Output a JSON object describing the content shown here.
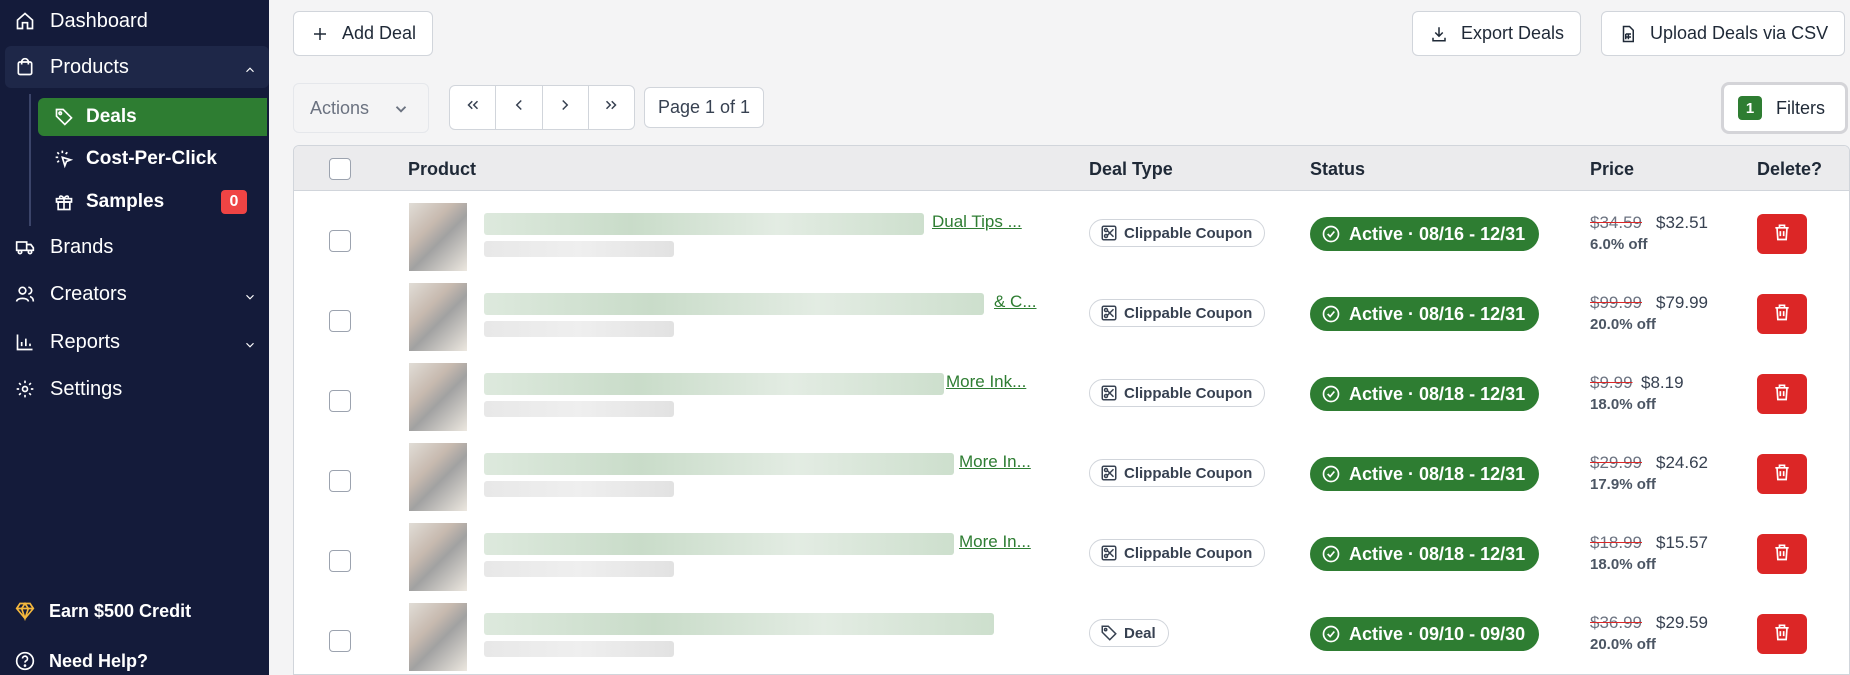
{
  "sidebar": {
    "items": [
      {
        "label": "Dashboard",
        "icon": "home-icon"
      },
      {
        "label": "Products",
        "icon": "shopping-bag-icon",
        "expanded": true
      },
      {
        "label": "Brands",
        "icon": "truck-icon"
      },
      {
        "label": "Creators",
        "icon": "users-icon"
      },
      {
        "label": "Reports",
        "icon": "bar-chart-icon"
      },
      {
        "label": "Settings",
        "icon": "gear-icon"
      }
    ],
    "sub_items": [
      {
        "label": "Deals",
        "icon": "tag-icon",
        "active": true
      },
      {
        "label": "Cost-Per-Click",
        "icon": "cursor-click-icon"
      },
      {
        "label": "Samples",
        "icon": "gift-icon",
        "badge": "0"
      }
    ],
    "earn_label": "Earn $500 Credit",
    "help_label": "Need Help?"
  },
  "toolbar": {
    "add_label": "Add Deal",
    "export_label": "Export Deals",
    "upload_label": "Upload Deals via CSV",
    "actions_label": "Actions",
    "page_label": "Page 1 of 1",
    "filters_count": "1",
    "filters_label": "Filters"
  },
  "table": {
    "headers": {
      "product": "Product",
      "deal_type": "Deal Type",
      "status": "Status",
      "price": "Price",
      "delete": "Delete?"
    },
    "rows": [
      {
        "link": "Dual Tips ...",
        "deal_type": "Clippable Coupon",
        "status": "Active · 08/16 - 12/31",
        "old_price": "$34.59",
        "new_price": "$32.51",
        "off": "6.0% off"
      },
      {
        "link": "& C...",
        "deal_type": "Clippable Coupon",
        "status": "Active · 08/16 - 12/31",
        "old_price": "$99.99",
        "new_price": "$79.99",
        "off": "20.0% off"
      },
      {
        "link": "More Ink...",
        "deal_type": "Clippable Coupon",
        "status": "Active · 08/18 - 12/31",
        "old_price": "$9.99",
        "new_price": "$8.19",
        "off": "18.0% off"
      },
      {
        "link": "More In...",
        "deal_type": "Clippable Coupon",
        "status": "Active · 08/18 - 12/31",
        "old_price": "$29.99",
        "new_price": "$24.62",
        "off": "17.9% off"
      },
      {
        "link": "More In...",
        "deal_type": "Clippable Coupon",
        "status": "Active · 08/18 - 12/31",
        "old_price": "$18.99",
        "new_price": "$15.57",
        "off": "18.0% off"
      },
      {
        "link": "",
        "deal_type": "Deal",
        "status": "Active · 09/10 - 09/30",
        "old_price": "$36.99",
        "new_price": "$29.59",
        "off": "20.0% off"
      }
    ]
  },
  "colors": {
    "sidebar_bg": "#141b3a",
    "accent_green": "#2e7d32",
    "danger_red": "#dc2626"
  }
}
